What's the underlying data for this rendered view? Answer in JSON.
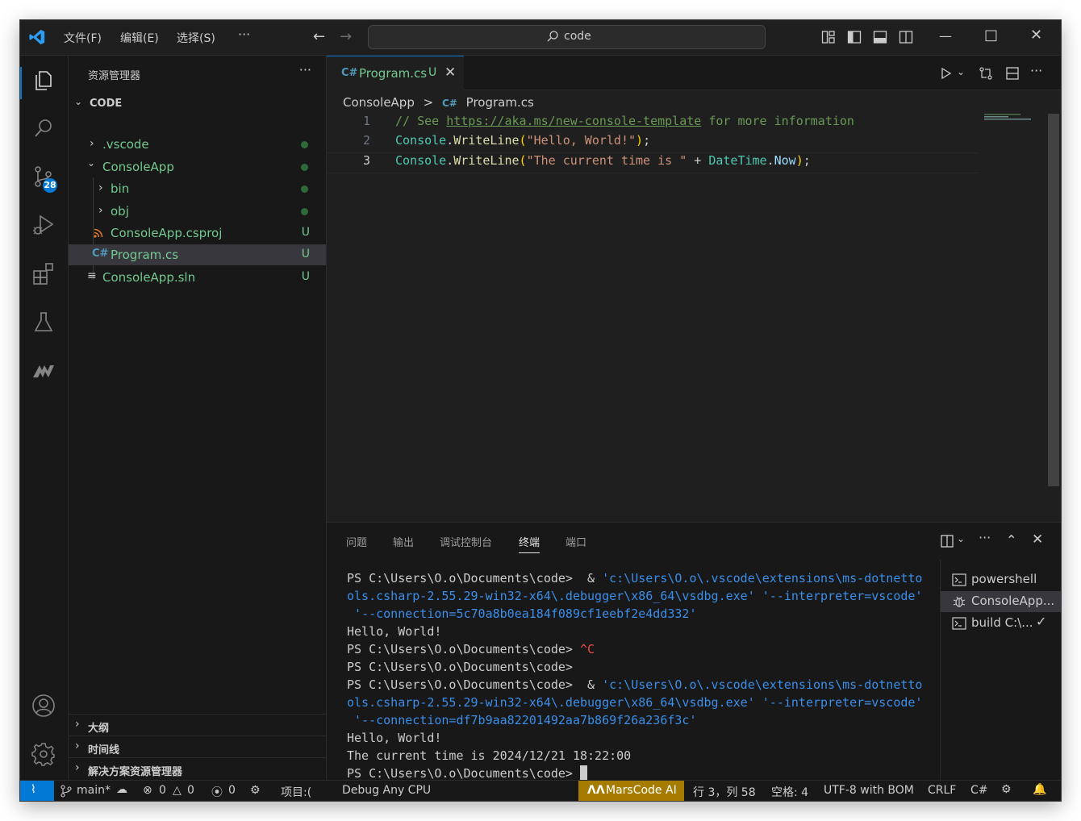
{
  "titlebar": {
    "menus": [
      "文件(F)",
      "编辑(E)",
      "选择(S)"
    ],
    "more": "···",
    "search_text": "code",
    "icons": [
      "vscode-logo-icon",
      "back-arrow-icon",
      "forward-arrow-icon",
      "search-icon",
      "customize-layout-icon",
      "toggle-sidebar-icon",
      "toggle-panel-icon",
      "toggle-secondary-sidebar-icon",
      "minimize-icon",
      "maximize-icon",
      "close-icon"
    ]
  },
  "activity_bar": {
    "items": [
      "explorer-icon",
      "search-icon",
      "source-control-icon",
      "run-debug-icon",
      "extensions-icon",
      "testing-icon",
      "marscode-icon",
      "accounts-icon",
      "settings-gear-icon"
    ],
    "scm_badge": "28"
  },
  "sidebar": {
    "title": "资源管理器",
    "more": "···",
    "root": "CODE",
    "tree": [
      {
        "label": ".vscode",
        "status": "dot"
      },
      {
        "label": "ConsoleApp",
        "status": "dot"
      },
      {
        "label": "bin",
        "status": "dot"
      },
      {
        "label": "obj",
        "status": "dot"
      },
      {
        "label": "ConsoleApp.csproj",
        "status": "U"
      },
      {
        "label": "Program.cs",
        "status": "U"
      },
      {
        "label": "ConsoleApp.sln",
        "status": "U"
      }
    ],
    "bottom_sections": [
      "大纲",
      "时间线",
      "解决方案资源管理器"
    ]
  },
  "editor": {
    "tab": {
      "label": "Program.cs",
      "status": "U"
    },
    "breadcrumb": {
      "folder": "ConsoleApp",
      "file": "Program.cs",
      "sep": ">"
    },
    "lines": [
      {
        "num": "1",
        "comment": "// See ",
        "link": "https://aka.ms/new-console-template",
        "comment_tail": " for more information"
      },
      {
        "num": "2",
        "type": "Console",
        "fn": "WriteLine",
        "str": "\"Hello, World!\""
      },
      {
        "num": "3",
        "type": "Console",
        "fn": "WriteLine",
        "str": "\"The current time is \"",
        "op": " + ",
        "type2": "DateTime",
        "prop": "Now"
      }
    ]
  },
  "panel": {
    "tabs": [
      "问题",
      "输出",
      "调试控制台",
      "终端",
      "端口"
    ],
    "active_tab": "终端",
    "terminal": {
      "prompt": "PS C:\\Users\\O.o\\Documents\\code>",
      "cmd_amp": "  & ",
      "cmd_path1": "'c:\\Users\\O.o\\.vscode\\extensions\\ms-dotnetto",
      "cmd_path2": "ols.csharp-2.55.29-win32-x64\\.debugger\\x86_64\\vsdbg.exe'",
      "cmd_interp": " '--interpreter=vscode'",
      "conn1": " '--connection=5c70a8b0ea184f089cf1eebf2e4dd332'",
      "hello": "Hello, World!",
      "ctrl_c": " ^C",
      "conn2": " '--connection=df7b9aa82201492aa7b869f26a236f3c'",
      "time_line": "The current time is 2024/12/21 18:22:00"
    },
    "term_list": [
      "powershell",
      "ConsoleApp...",
      "build C:\\..."
    ],
    "check": "✓"
  },
  "statusbar": {
    "branch": "main*",
    "errors": "0",
    "warnings": "0",
    "ports": "0",
    "project": "项目:(",
    "debug_cfg": "Debug Any CPU",
    "marscode": "MarsCode AI",
    "position": "行 3，列 58",
    "spaces": "空格: 4",
    "encoding": "UTF-8 with BOM",
    "eol": "CRLF",
    "language": "C#"
  },
  "colors": {
    "accent": "#0078d4",
    "git_untracked": "#73c991",
    "marscode_bg": "#a67c00"
  }
}
